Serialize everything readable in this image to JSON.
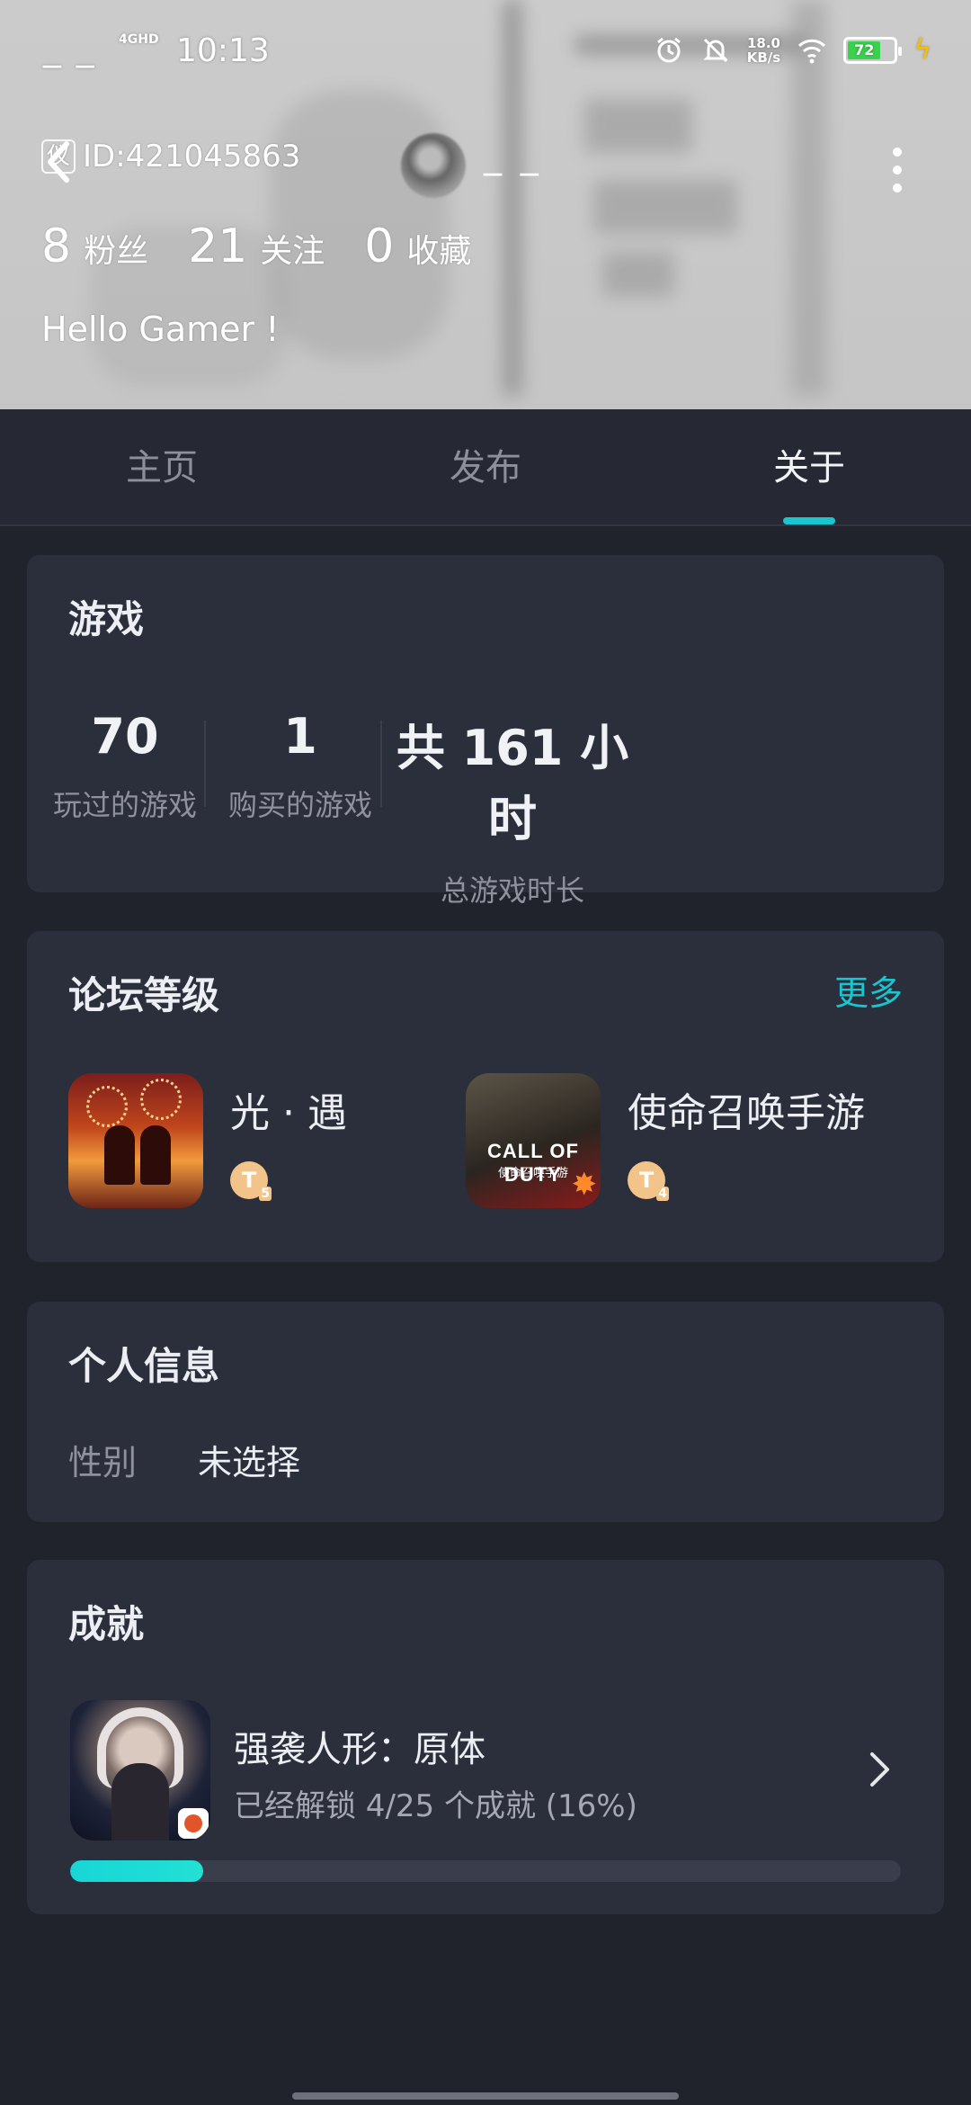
{
  "status_bar": {
    "left_text": "_ _",
    "network": "4GHD",
    "time": "10:13",
    "speed_value": "18.0",
    "speed_unit": "KB/s",
    "battery": "72",
    "battery_level": 0.72
  },
  "profile": {
    "id_tag": "仪",
    "id_text": "ID:421045863",
    "nickname": "_ _",
    "followers_count": "8",
    "followers_label": "粉丝",
    "following_count": "21",
    "following_label": "关注",
    "favorites_count": "0",
    "favorites_label": "收藏",
    "bio": "Hello Gamer !"
  },
  "tabs": [
    {
      "label": "主页",
      "active": false
    },
    {
      "label": "发布",
      "active": false
    },
    {
      "label": "关于",
      "active": true
    }
  ],
  "games_card": {
    "title": "游戏",
    "stats": [
      {
        "value": "70",
        "label": "玩过的游戏"
      },
      {
        "value": "1",
        "label": "购买的游戏"
      },
      {
        "value": "共 161 小时",
        "label": "总游戏时长"
      }
    ]
  },
  "forum_card": {
    "title": "论坛等级",
    "more": "更多",
    "items": [
      {
        "name": "光 · 遇",
        "badge": "T",
        "level": "5"
      },
      {
        "name": "使命召唤手游",
        "badge": "T",
        "level": "4"
      }
    ],
    "cod_icon_text": "CALL OF DUTY",
    "cod_icon_sub": "使命召唤手游"
  },
  "info_card": {
    "title": "个人信息",
    "gender_label": "性别",
    "gender_value": "未选择"
  },
  "achievement_card": {
    "title": "成就",
    "game_name": "强袭人形：原体",
    "progress_text": "已经解锁 4/25 个成就 (16%)",
    "progress_ratio": 0.16
  },
  "colors": {
    "background": "#20222c",
    "card": "#2b2e3b",
    "accent": "#19c6d0",
    "progress": "#17d6d6"
  }
}
